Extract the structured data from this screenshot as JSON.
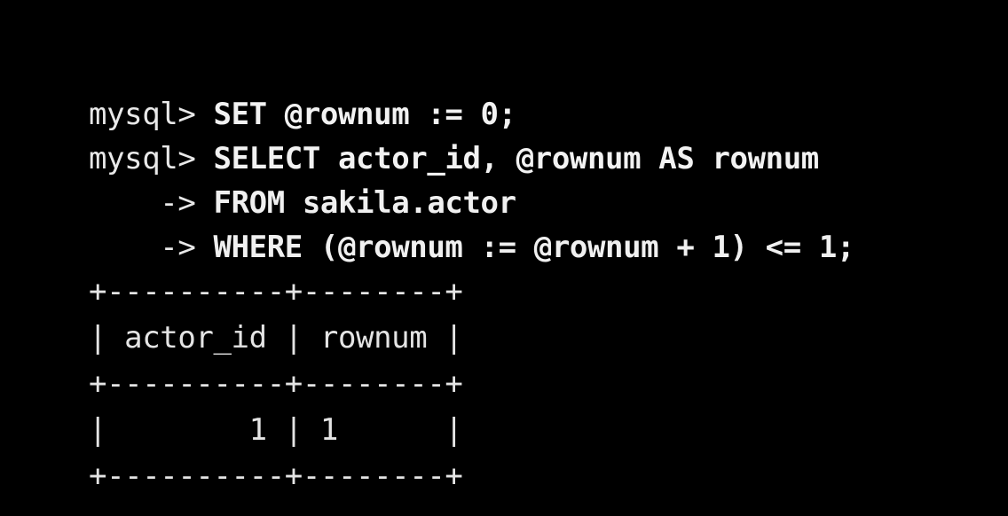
{
  "terminal": {
    "lines": [
      {
        "prompt": "mysql> ",
        "command": "SET @rownum := 0;"
      },
      {
        "prompt": "mysql> ",
        "command": "SELECT actor_id, @rownum AS rownum"
      },
      {
        "prompt": "    -> ",
        "command": "FROM sakila.actor"
      },
      {
        "prompt": "    -> ",
        "command": "WHERE (@rownum := @rownum + 1) <= 1;"
      }
    ],
    "result_table": {
      "border": "+----------+--------+",
      "header_row": "| actor_id | rownum |",
      "rows": [
        "|        1 | 1      |"
      ]
    }
  }
}
